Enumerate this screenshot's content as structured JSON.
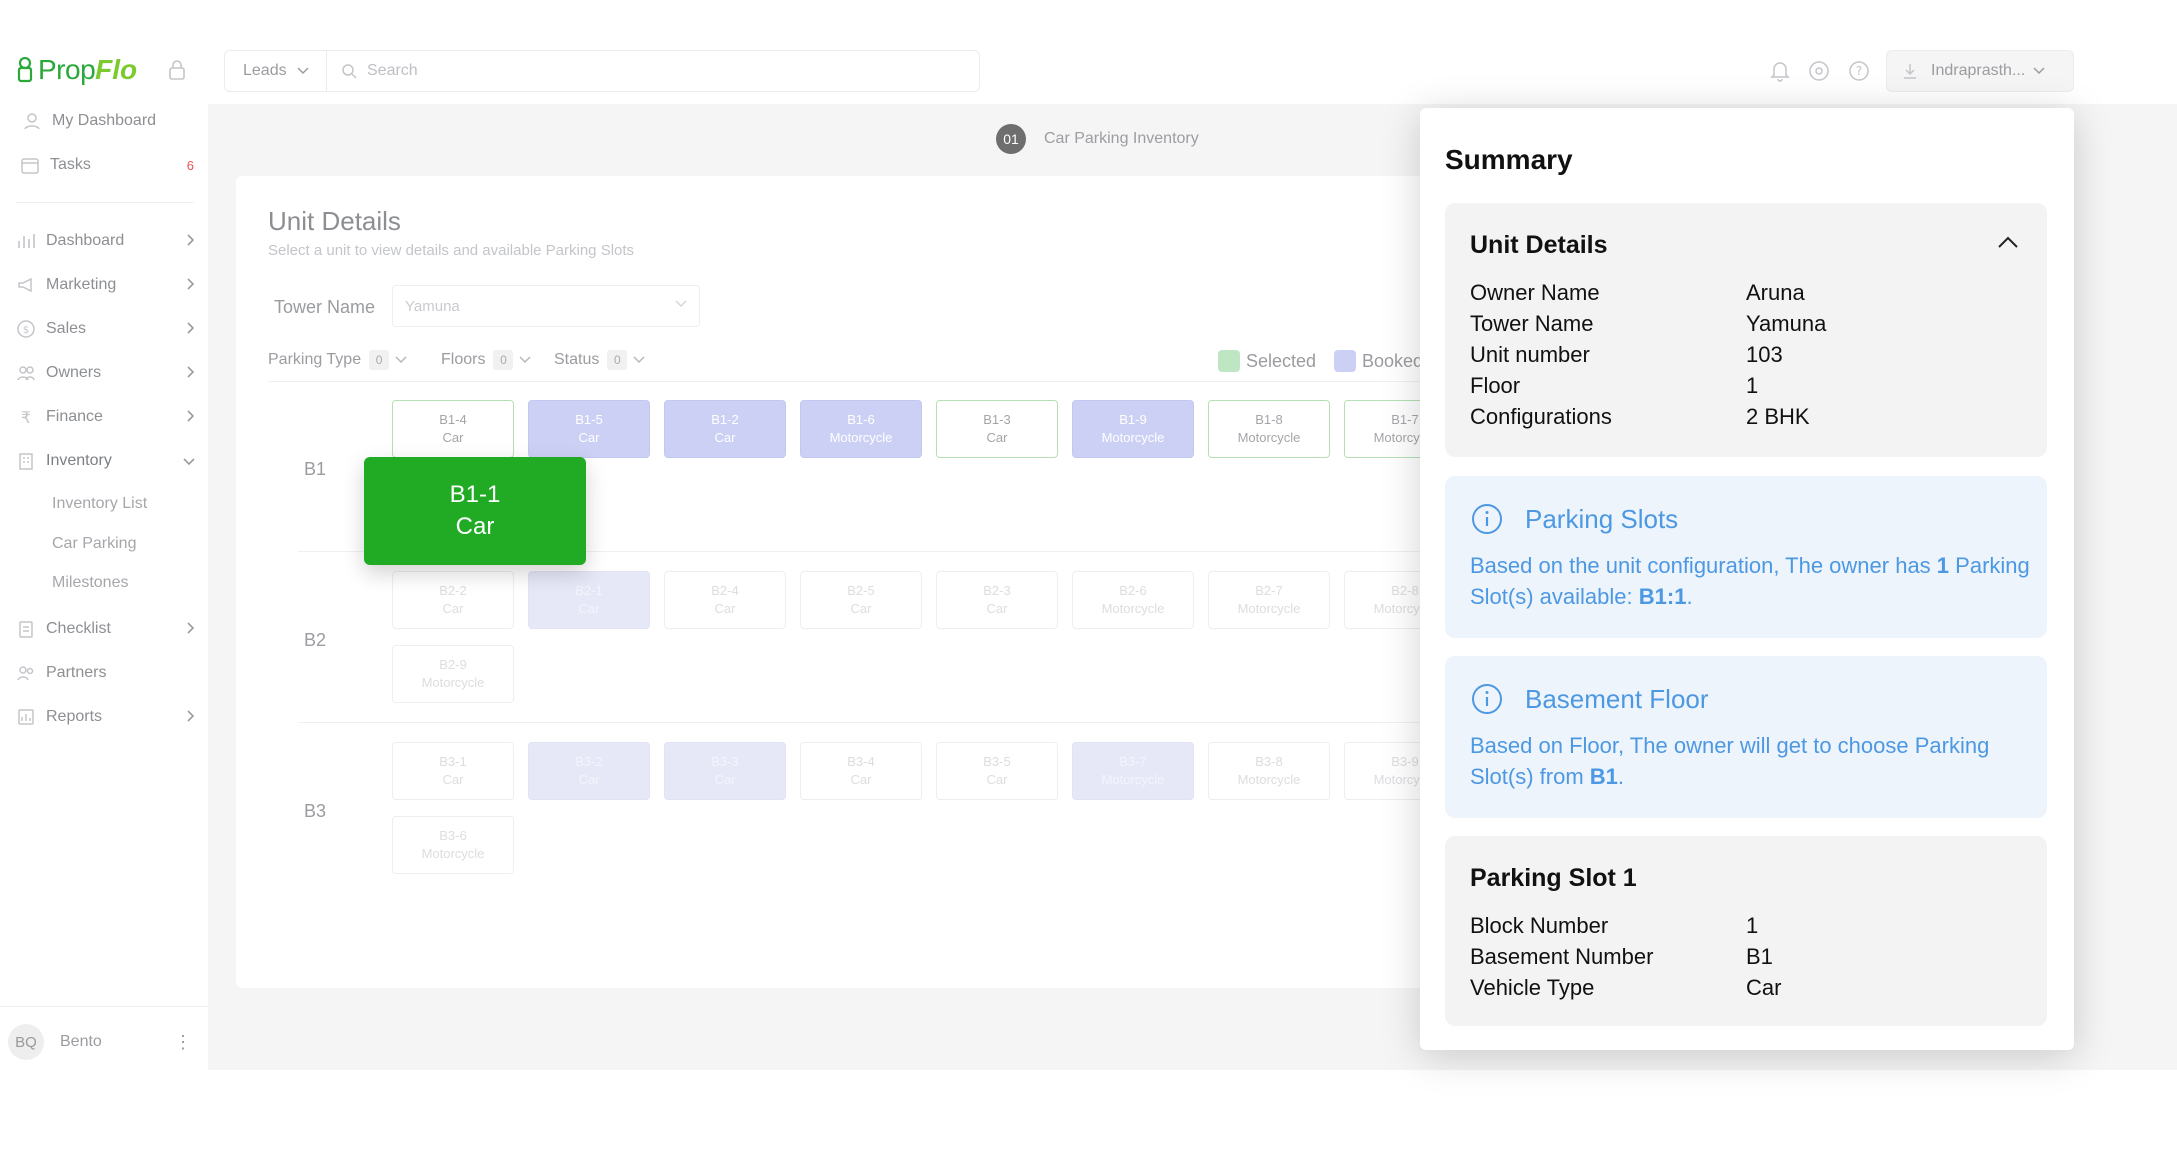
{
  "brand": {
    "part1": "Prop",
    "part2": "Flo"
  },
  "sidebar": {
    "top_items": [
      {
        "label": "My Dashboard",
        "icon": "user-icon"
      },
      {
        "label": "Tasks",
        "icon": "calendar-icon",
        "badge": "6"
      }
    ],
    "items": [
      {
        "label": "Dashboard",
        "icon": "bar-chart-icon"
      },
      {
        "label": "Marketing",
        "icon": "megaphone-icon"
      },
      {
        "label": "Sales",
        "icon": "dollar-icon"
      },
      {
        "label": "Owners",
        "icon": "users-icon"
      },
      {
        "label": "Finance",
        "icon": "rupee-icon"
      },
      {
        "label": "Inventory",
        "icon": "building-icon"
      },
      {
        "label": "Checklist",
        "icon": "checklist-icon"
      },
      {
        "label": "Partners",
        "icon": "partners-icon"
      },
      {
        "label": "Reports",
        "icon": "report-icon"
      }
    ],
    "inventory_sub": [
      "Inventory List",
      "Car Parking",
      "Milestones"
    ],
    "user": {
      "initials": "BQ",
      "name": "Bento"
    }
  },
  "topbar": {
    "module": "Leads",
    "search_placeholder": "Search",
    "account": "Indraprasth..."
  },
  "stepper": {
    "number": "01",
    "label": "Car Parking Inventory"
  },
  "unit_details": {
    "title": "Unit Details",
    "subtitle": "Select a unit to view details and available Parking Slots",
    "tower_label": "Tower Name",
    "tower_value": "Yamuna"
  },
  "filters": [
    {
      "label": "Parking Type",
      "count": "0"
    },
    {
      "label": "Floors",
      "count": "0"
    },
    {
      "label": "Status",
      "count": "0"
    }
  ],
  "legend": [
    {
      "label": "Selected",
      "color": "#bfe6c3"
    },
    {
      "label": "Booked",
      "color": "#ccd0f4"
    }
  ],
  "rows": [
    {
      "label": "B1",
      "slots": [
        {
          "id": "B1-4",
          "type": "Car",
          "state": "avail-strong"
        },
        {
          "id": "B1-5",
          "type": "Car",
          "state": "booked-strong"
        },
        {
          "id": "B1-2",
          "type": "Car",
          "state": "booked-strong"
        },
        {
          "id": "B1-6",
          "type": "Motorcycle",
          "state": "booked-strong"
        },
        {
          "id": "B1-3",
          "type": "Car",
          "state": "avail-strong"
        },
        {
          "id": "B1-9",
          "type": "Motorcycle",
          "state": "booked-strong"
        },
        {
          "id": "B1-8",
          "type": "Motorcycle",
          "state": "avail-strong"
        },
        {
          "id": "B1-7",
          "type": "Motorcycle",
          "state": "avail-strong"
        }
      ]
    },
    {
      "label": "B2",
      "slots": [
        {
          "id": "B2-2",
          "type": "Car",
          "state": "avail-faint"
        },
        {
          "id": "B2-1",
          "type": "Car",
          "state": "booked-faint"
        },
        {
          "id": "B2-4",
          "type": "Car",
          "state": "avail-faint"
        },
        {
          "id": "B2-5",
          "type": "Car",
          "state": "avail-faint"
        },
        {
          "id": "B2-3",
          "type": "Car",
          "state": "avail-faint"
        },
        {
          "id": "B2-6",
          "type": "Motorcycle",
          "state": "avail-faint"
        },
        {
          "id": "B2-7",
          "type": "Motorcycle",
          "state": "avail-faint"
        },
        {
          "id": "B2-8",
          "type": "Motorcycle",
          "state": "avail-faint"
        },
        {
          "id": "B2-9",
          "type": "Motorcycle",
          "state": "avail-faint"
        }
      ]
    },
    {
      "label": "B3",
      "slots": [
        {
          "id": "B3-1",
          "type": "Car",
          "state": "avail-faint"
        },
        {
          "id": "B3-2",
          "type": "Car",
          "state": "booked-faint"
        },
        {
          "id": "B3-3",
          "type": "Car",
          "state": "booked-faint"
        },
        {
          "id": "B3-4",
          "type": "Car",
          "state": "avail-faint"
        },
        {
          "id": "B3-5",
          "type": "Car",
          "state": "avail-faint"
        },
        {
          "id": "B3-7",
          "type": "Motorcycle",
          "state": "booked-faint"
        },
        {
          "id": "B3-8",
          "type": "Motorcycle",
          "state": "avail-faint"
        },
        {
          "id": "B3-9",
          "type": "Motorcycle",
          "state": "avail-faint"
        },
        {
          "id": "B3-6",
          "type": "Motorcycle",
          "state": "avail-faint"
        }
      ]
    }
  ],
  "selected_slot": {
    "id": "B1-1",
    "type": "Car"
  },
  "summary": {
    "title": "Summary",
    "unit_details": {
      "title": "Unit Details",
      "fields": [
        {
          "key": "Owner Name",
          "value": "Aruna"
        },
        {
          "key": "Tower Name",
          "value": "Yamuna"
        },
        {
          "key": "Unit number",
          "value": "103"
        },
        {
          "key": "Floor",
          "value": "1"
        },
        {
          "key": "Configurations",
          "value": "2 BHK"
        }
      ]
    },
    "parking_slots": {
      "title": "Parking Slots",
      "text_1": "Based on the unit configuration, The owner has ",
      "bold_1": "1",
      "text_2": " Parking Slot(s) available: ",
      "bold_2": "B1:1",
      "text_3": "."
    },
    "basement_floor": {
      "title": "Basement Floor",
      "text_1": "Based on Floor, The owner will get to choose Parking Slot(s) from ",
      "bold_1": "B1",
      "text_2": "."
    },
    "parking_slot_1": {
      "title": "Parking Slot 1",
      "fields": [
        {
          "key": "Block Number",
          "value": "1"
        },
        {
          "key": "Basement Number",
          "value": "B1"
        },
        {
          "key": "Vehicle Type",
          "value": "Car"
        }
      ]
    }
  }
}
